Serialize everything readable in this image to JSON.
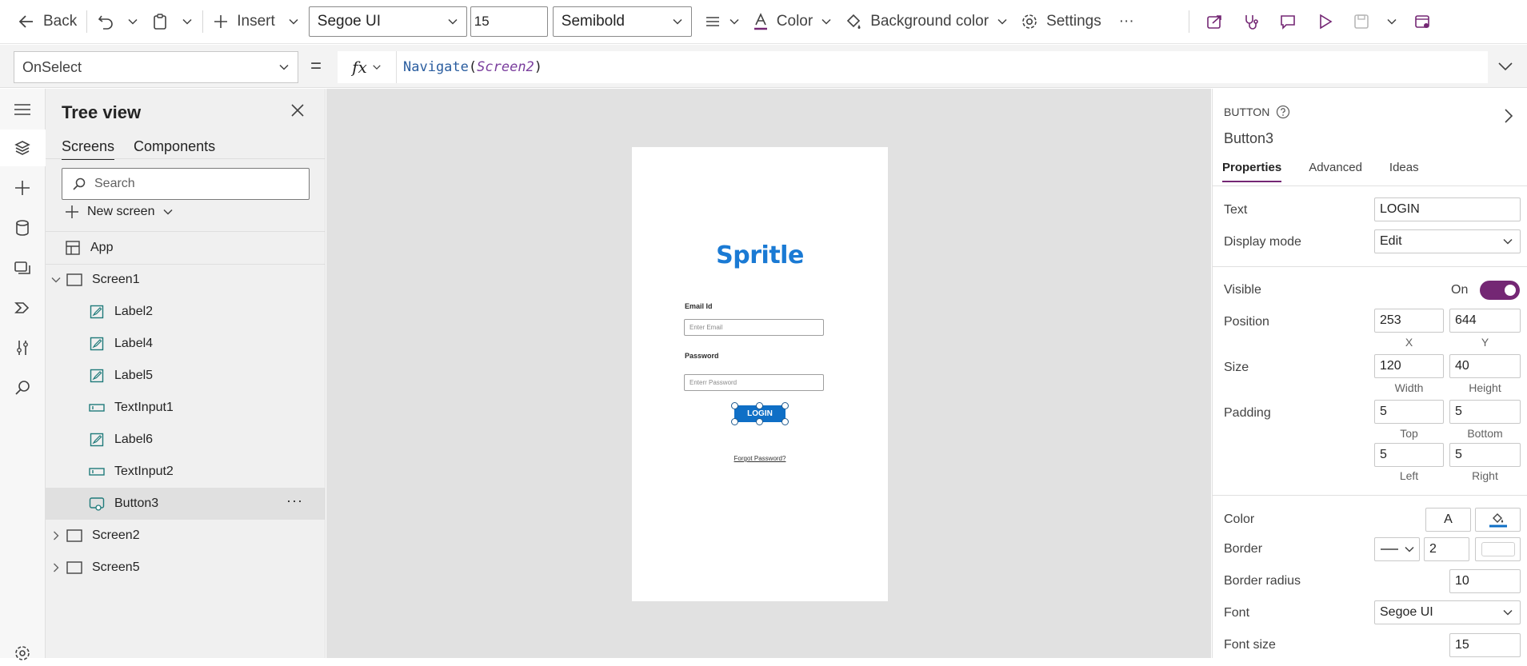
{
  "toolbar": {
    "back_label": "Back",
    "insert_label": "Insert",
    "font_family": "Segoe UI",
    "font_size": "15",
    "font_weight": "Semibold",
    "color_label": "Color",
    "bg_color_label": "Background color",
    "settings_label": "Settings",
    "more_label": "···"
  },
  "formula_bar": {
    "property": "OnSelect",
    "equals": "=",
    "fx_label": "fx",
    "function_name": "Navigate",
    "open_paren": "(",
    "argument": "Screen2",
    "close_paren": ")"
  },
  "tree": {
    "title": "Tree view",
    "tabs": [
      "Screens",
      "Components"
    ],
    "search_placeholder": "Search",
    "new_screen_label": "New screen",
    "app_label": "App",
    "nodes": [
      {
        "label": "Screen1",
        "icon": "screen-icon"
      },
      {
        "label": "Label2",
        "icon": "label-icon"
      },
      {
        "label": "Label4",
        "icon": "label-icon"
      },
      {
        "label": "Label5",
        "icon": "label-icon"
      },
      {
        "label": "TextInput1",
        "icon": "text-input-icon"
      },
      {
        "label": "Label6",
        "icon": "label-icon"
      },
      {
        "label": "TextInput2",
        "icon": "text-input-icon"
      },
      {
        "label": "Button3",
        "icon": "button-icon",
        "selected": true
      },
      {
        "label": "Screen2",
        "icon": "screen-icon"
      },
      {
        "label": "Screen5",
        "icon": "screen-icon"
      }
    ],
    "more_label": "···"
  },
  "canvas": {
    "logo_text": "Spritle",
    "email_label": "Email Id",
    "email_placeholder": "Enter Email",
    "password_label": "Password",
    "password_placeholder": "Enterr Password",
    "login_label": "LOGIN",
    "forgot_label": "Forgot Password?"
  },
  "properties": {
    "type_label": "BUTTON",
    "control_name": "Button3",
    "tabs": [
      "Properties",
      "Advanced",
      "Ideas"
    ],
    "text_label": "Text",
    "text_value": "LOGIN",
    "display_mode_label": "Display mode",
    "display_mode_value": "Edit",
    "visible_label": "Visible",
    "visible_state": "On",
    "position_label": "Position",
    "position_x": "253",
    "position_y": "644",
    "x_cap": "X",
    "y_cap": "Y",
    "size_label": "Size",
    "size_width": "120",
    "size_height": "40",
    "width_cap": "Width",
    "height_cap": "Height",
    "padding_label": "Padding",
    "padding_top": "5",
    "padding_bottom": "5",
    "padding_left": "5",
    "padding_right": "5",
    "top_cap": "Top",
    "bottom_cap": "Bottom",
    "left_cap": "Left",
    "right_cap": "Right",
    "color_label": "Color",
    "color_text_glyph": "A",
    "border_label": "Border",
    "border_width": "2",
    "border_radius_label": "Border radius",
    "border_radius_value": "10",
    "font_label": "Font",
    "font_value": "Segoe UI",
    "font_size_label": "Font size",
    "font_size_value": "15"
  },
  "colors": {
    "accent": "#742774",
    "button_fill": "#0f6fc6",
    "logo": "#1a7ad4"
  }
}
